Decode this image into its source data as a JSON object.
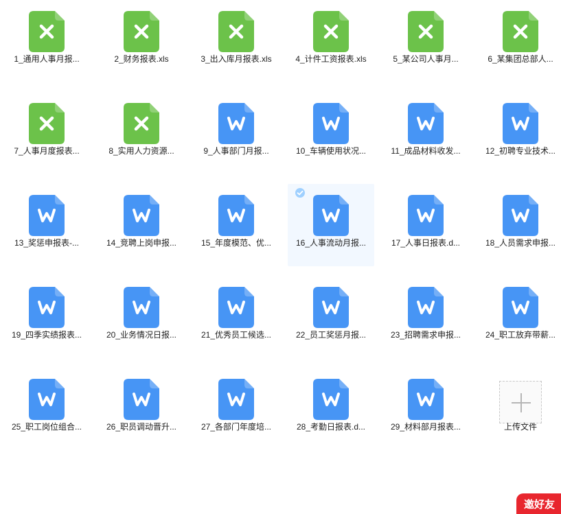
{
  "files": [
    {
      "name": "1_通用人事月报...",
      "type": "xls",
      "selected": false
    },
    {
      "name": "2_财务报表.xls",
      "type": "xls",
      "selected": false
    },
    {
      "name": "3_出入库月报表.xls",
      "type": "xls",
      "selected": false
    },
    {
      "name": "4_计件工资报表.xls",
      "type": "xls",
      "selected": false
    },
    {
      "name": "5_某公司人事月...",
      "type": "xls",
      "selected": false
    },
    {
      "name": "6_某集团总部人...",
      "type": "xls",
      "selected": false
    },
    {
      "name": "7_人事月度报表...",
      "type": "xls",
      "selected": false
    },
    {
      "name": "8_实用人力资源...",
      "type": "xls",
      "selected": false
    },
    {
      "name": "9_人事部门月报...",
      "type": "doc",
      "selected": false
    },
    {
      "name": "10_车辆使用状况...",
      "type": "doc",
      "selected": false
    },
    {
      "name": "11_成品材料收发...",
      "type": "doc",
      "selected": false
    },
    {
      "name": "12_初聘专业技术...",
      "type": "doc",
      "selected": false
    },
    {
      "name": "13_奖惩申报表-...",
      "type": "doc",
      "selected": false
    },
    {
      "name": "14_竞聘上岗申报...",
      "type": "doc",
      "selected": false
    },
    {
      "name": "15_年度模范、优...",
      "type": "doc",
      "selected": false
    },
    {
      "name": "16_人事流动月报...",
      "type": "doc",
      "selected": true
    },
    {
      "name": "17_人事日报表.d...",
      "type": "doc",
      "selected": false
    },
    {
      "name": "18_人员需求申报...",
      "type": "doc",
      "selected": false
    },
    {
      "name": "19_四季实绩报表...",
      "type": "doc",
      "selected": false
    },
    {
      "name": "20_业务情况日报...",
      "type": "doc",
      "selected": false
    },
    {
      "name": "21_优秀员工候选...",
      "type": "doc",
      "selected": false
    },
    {
      "name": "22_员工奖惩月报...",
      "type": "doc",
      "selected": false
    },
    {
      "name": "23_招聘需求申报...",
      "type": "doc",
      "selected": false
    },
    {
      "name": "24_职工放弃带薪...",
      "type": "doc",
      "selected": false
    },
    {
      "name": "25_职工岗位组合...",
      "type": "doc",
      "selected": false
    },
    {
      "name": "26_职员调动晋升...",
      "type": "doc",
      "selected": false
    },
    {
      "name": "27_各部门年度培...",
      "type": "doc",
      "selected": false
    },
    {
      "name": "28_考勤日报表.d...",
      "type": "doc",
      "selected": false
    },
    {
      "name": "29_材料部月报表...",
      "type": "doc",
      "selected": false
    }
  ],
  "upload": {
    "label": "上传文件",
    "icon": "plus-icon"
  },
  "invite_banner": {
    "label": "邀好友"
  },
  "colors": {
    "xls_green": "#6cc24a",
    "doc_blue": "#4795f5",
    "selected_bg": "#f2f8ff",
    "check_blue": "#9fd0ff",
    "banner_red": "#e8262e"
  },
  "icons": {
    "xls": "excel-file-icon",
    "doc": "word-file-icon",
    "check": "check-icon"
  }
}
